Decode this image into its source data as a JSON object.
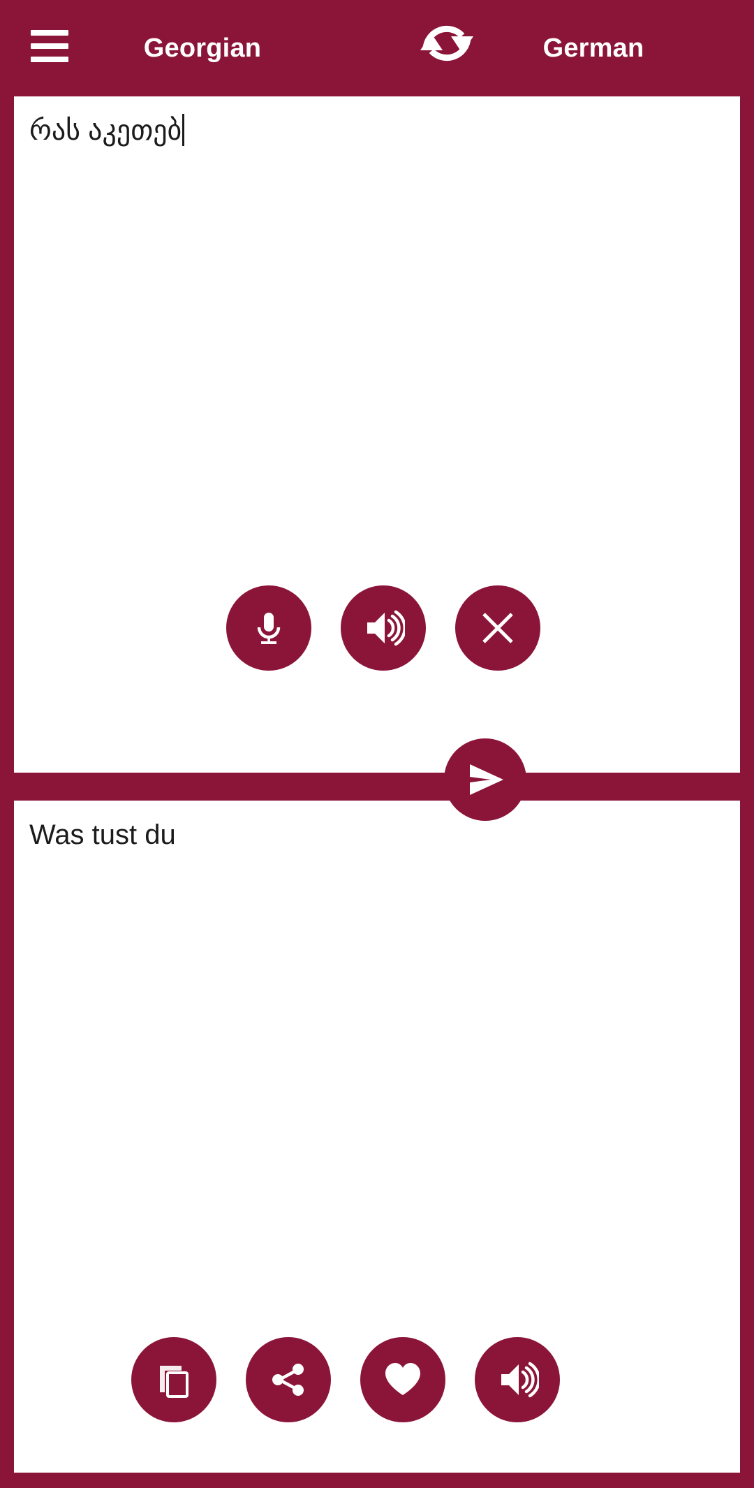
{
  "app": {
    "brand_color": "#8B1538",
    "panel_color": "#FFFFFF",
    "icon_color": "#FFFFFF",
    "text_color": "#1B1B1B"
  },
  "header": {
    "menu_icon": "hamburger-menu-icon",
    "source_language": "Georgian",
    "target_language": "German",
    "swap_icon": "swap-languages-icon"
  },
  "source_panel": {
    "text": "რას აკეთებ",
    "placeholder": "",
    "has_caret": true,
    "buttons": [
      {
        "name": "microphone",
        "icon": "microphone-icon",
        "label": "Speak"
      },
      {
        "name": "listen",
        "icon": "speaker-icon",
        "label": "Listen"
      },
      {
        "name": "clear",
        "icon": "close-x-icon",
        "label": "Clear"
      }
    ]
  },
  "send_button": {
    "icon": "send-icon",
    "label": "Translate"
  },
  "target_panel": {
    "text": "Was tust du",
    "placeholder": "",
    "buttons": [
      {
        "name": "copy",
        "icon": "copy-icon",
        "label": "Copy"
      },
      {
        "name": "share",
        "icon": "share-icon",
        "label": "Share"
      },
      {
        "name": "favorite",
        "icon": "heart-icon",
        "label": "Favorite"
      },
      {
        "name": "listen",
        "icon": "speaker-icon",
        "label": "Listen"
      }
    ]
  }
}
